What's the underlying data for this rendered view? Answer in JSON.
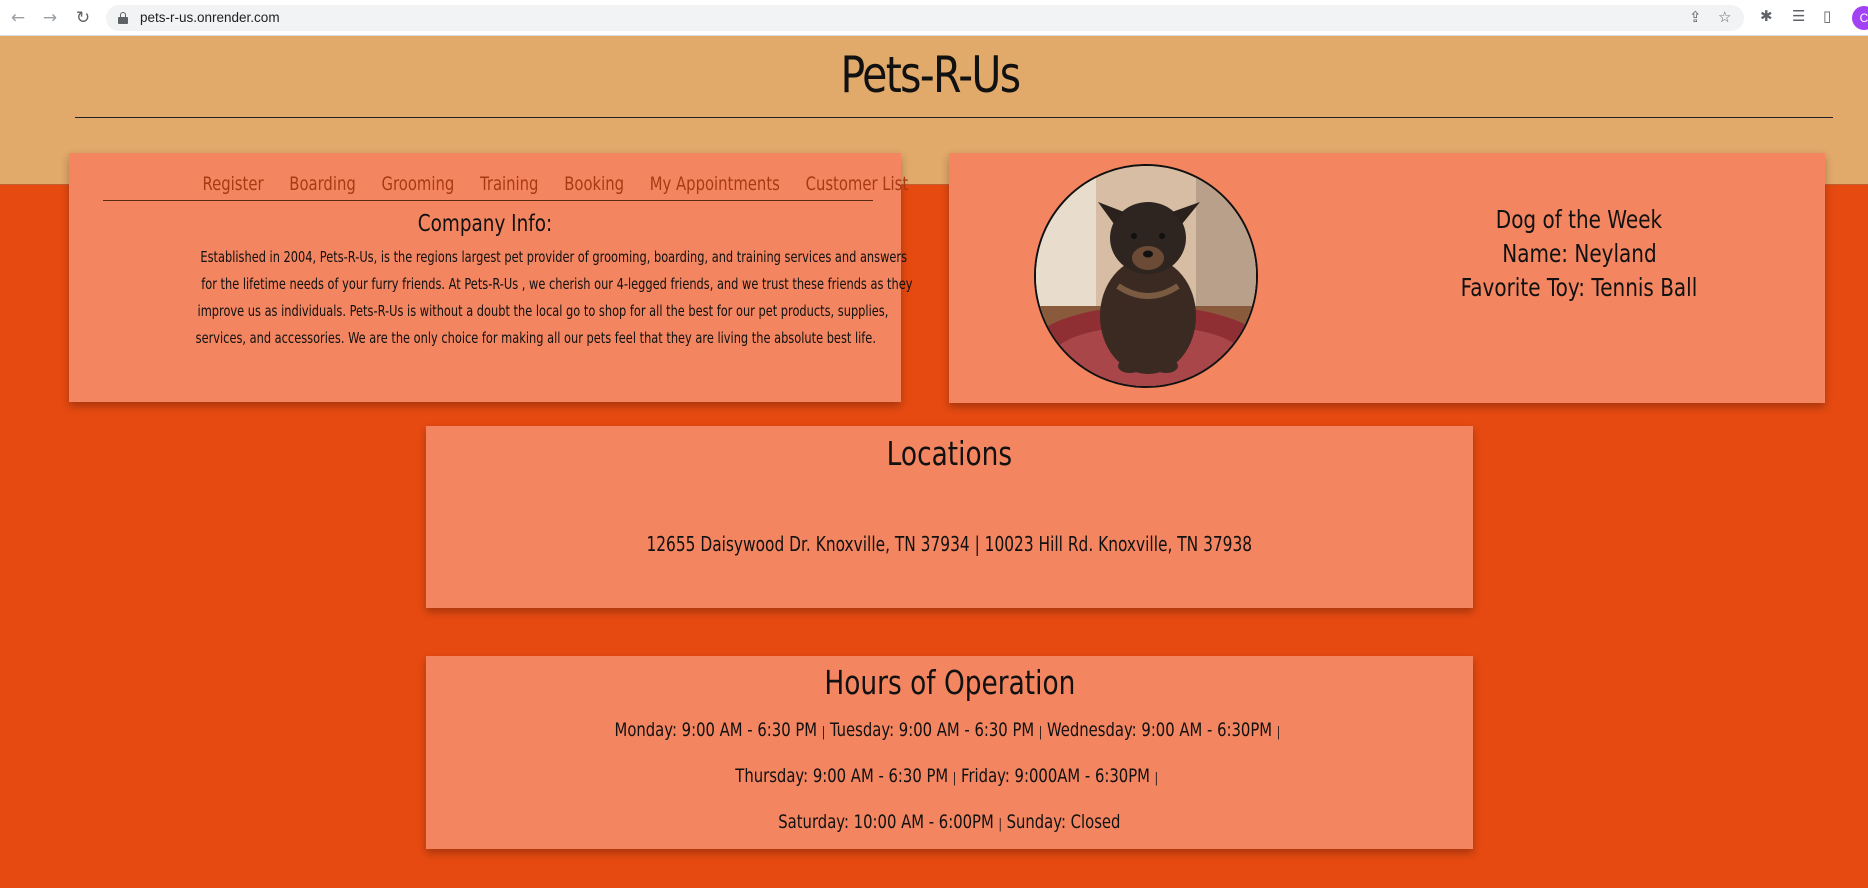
{
  "browser": {
    "url": "pets-r-us.onrender.com",
    "profile_initial": "C"
  },
  "site": {
    "title": "Pets-R-Us"
  },
  "nav": {
    "items": [
      {
        "label": "Register"
      },
      {
        "label": "Boarding"
      },
      {
        "label": "Grooming"
      },
      {
        "label": "Training"
      },
      {
        "label": "Booking"
      },
      {
        "label": "My Appointments"
      },
      {
        "label": "Customer List"
      }
    ]
  },
  "company": {
    "heading": "Company Info:",
    "lines": [
      "Established in 2004, Pets-R-Us, is the regions largest pet provider of grooming, boarding, and training services and answers",
      "for the lifetime needs of your furry friends. At Pets-R-Us , we cherish our 4-legged friends, and we trust these friends as they",
      "improve us as individuals. Pets-R-Us is without a doubt the local go to shop for all the best for our pet products, supplies,",
      "services, and accessories. We are the only choice for making all our pets feel that they are living the absolute best life."
    ]
  },
  "dog_of_week": {
    "heading": "Dog of the Week",
    "name": "Name: Neyland",
    "toy": "Favorite Toy: Tennis Ball"
  },
  "locations": {
    "title": "Locations",
    "text": "12655 Daisywood Dr. Knoxville, TN 37934 | 10023 Hill Rd. Knoxville, TN 37938"
  },
  "hours": {
    "title": "Hours of Operation",
    "monday": "Monday: 9:00 AM - 6:30 PM",
    "tuesday": "Tuesday: 9:00 AM - 6:30 PM",
    "wednesday": "Wednesday: 9:00 AM - 6:30PM",
    "thursday": "Thursday: 9:00 AM - 6:30 PM",
    "friday": "Friday: 9:000AM - 6:30PM",
    "saturday": "Saturday: 10:00 AM - 6:00PM",
    "sunday": "Sunday: Closed",
    "separator": "|"
  }
}
